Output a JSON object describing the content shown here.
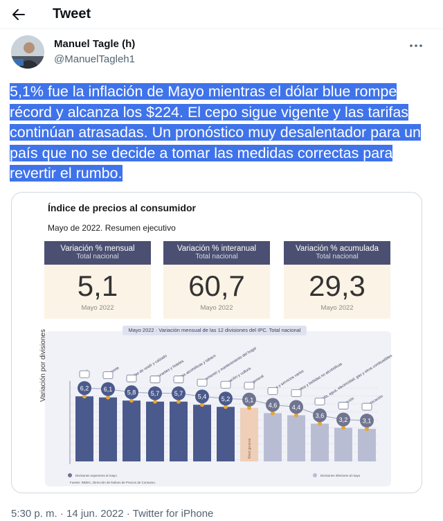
{
  "header": {
    "title": "Tweet"
  },
  "author": {
    "name": "Manuel Tagle (h)",
    "handle": "@ManuelTagleh1"
  },
  "tweet": {
    "text": "5,1% fue la inflación de Mayo mientras el dólar blue rompe récord y alcanza los $224. El cepo sigue vigente y las tarifas continúan atrasadas. Un pronóstico muy desalentador para un país que no se decide a tomar las medidas correctas para revertir el rumbo.",
    "highlight_color": "#3f73ea"
  },
  "media": {
    "title": "Índice de precios al consumidor",
    "subtitle": "Mayo de 2022. Resumen ejecutivo",
    "kpis": [
      {
        "label": "Variación % mensual",
        "scope": "Total nacional",
        "value": "5,1",
        "period": "Mayo 2022"
      },
      {
        "label": "Variación % interanual",
        "scope": "Total nacional",
        "value": "60,7",
        "period": "Mayo 2022"
      },
      {
        "label": "Variación % acumulada",
        "scope": "Total nacional",
        "value": "29,3",
        "period": "Mayo 2022"
      }
    ],
    "chart_caption": "Mayo 2022 · Variación mensual de las 12 divisiones del IPC. Total nacional",
    "ylabel": "Variación por divisiones",
    "legend_left": "Divisiones superiores al mayo",
    "legend_right": "Divisiones inferiores al mayo",
    "source": "Fuente: INDEC, Dirección de Índices de Precios de Consumo.",
    "total_label": "Nivel general"
  },
  "chart_data": {
    "type": "bar",
    "categories": [
      "Salud",
      "Transporte",
      "Prendas de vestir y calzado",
      "Restaurantes y hoteles",
      "Bebidas alcohólicas y tabaco",
      "Equipamiento y mantenimiento del hogar",
      "Recreación y cultura",
      "Nivel general",
      "Bienes y servicios varios",
      "Alimentos y bebidas no alcohólicas",
      "Vivienda, agua, electricidad, gas y otros combustibles",
      "Educación",
      "Comunicación"
    ],
    "values": [
      6.2,
      6.1,
      5.8,
      5.7,
      5.7,
      5.4,
      5.2,
      5.1,
      4.6,
      4.4,
      3.6,
      3.2,
      3.1
    ],
    "labels": [
      "6,2",
      "6,1",
      "5,8",
      "5,7",
      "5,7",
      "5,4",
      "5,2",
      "5,1",
      "4,6",
      "4,4",
      "3,6",
      "3,2",
      "3,1"
    ],
    "ylim": [
      0,
      7
    ],
    "colors": {
      "above": "#4b5a8c",
      "below": "#b9bdd4",
      "total": "#efcfb8",
      "marker": "#e8a532",
      "circle_above": "#4b5a8c",
      "circle_below": "#6f7590"
    }
  },
  "footer": {
    "meta": "5:30 p. m. · 14 jun. 2022 · Twitter for iPhone"
  },
  "colors": {
    "secondary_text": "#536471",
    "border": "#cfd9de"
  }
}
